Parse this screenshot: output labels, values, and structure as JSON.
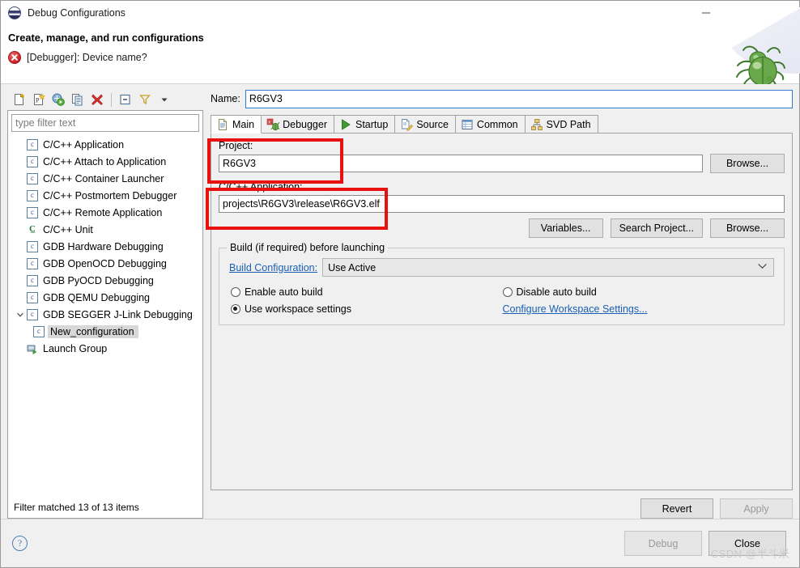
{
  "window": {
    "title": "Debug Configurations",
    "icon": "debug-configurations-icon",
    "minimize_label": "—",
    "maximize_label": "☐",
    "close_label": "✕"
  },
  "header": {
    "title": "Create, manage, and run configurations",
    "error_message": "[Debugger]: Device name?",
    "error_icon": "error-icon",
    "decoration_icon": "green-bug-icon"
  },
  "toolbar": {
    "buttons": [
      {
        "name": "new-launch-configuration-icon",
        "tooltip": "New launch configuration"
      },
      {
        "name": "new-prototype-icon",
        "tooltip": "New prototype"
      },
      {
        "name": "export-launch-configuration-icon",
        "tooltip": "Export"
      },
      {
        "name": "duplicate-icon",
        "tooltip": "Duplicate"
      },
      {
        "name": "delete-icon",
        "tooltip": "Delete"
      },
      {
        "name": "collapse-all-icon",
        "tooltip": "Collapse All"
      },
      {
        "name": "filter-icon",
        "tooltip": "Filter"
      },
      {
        "name": "view-menu-icon",
        "tooltip": "View Menu"
      }
    ]
  },
  "filter": {
    "placeholder": "type filter text",
    "value": ""
  },
  "tree": {
    "items": [
      {
        "label": "C/C++ Application",
        "icon": "c-launch-icon",
        "level": 0,
        "expandable": false,
        "selected": false
      },
      {
        "label": "C/C++ Attach to Application",
        "icon": "c-launch-icon",
        "level": 0,
        "expandable": false,
        "selected": false
      },
      {
        "label": "C/C++ Container Launcher",
        "icon": "c-launch-icon",
        "level": 0,
        "expandable": false,
        "selected": false
      },
      {
        "label": "C/C++ Postmortem Debugger",
        "icon": "c-launch-icon",
        "level": 0,
        "expandable": false,
        "selected": false
      },
      {
        "label": "C/C++ Remote Application",
        "icon": "c-launch-icon",
        "level": 0,
        "expandable": false,
        "selected": false
      },
      {
        "label": "C/C++ Unit",
        "icon": "cunit-icon",
        "level": 0,
        "expandable": false,
        "selected": false
      },
      {
        "label": "GDB Hardware Debugging",
        "icon": "c-launch-icon",
        "level": 0,
        "expandable": false,
        "selected": false
      },
      {
        "label": "GDB OpenOCD Debugging",
        "icon": "c-launch-icon",
        "level": 0,
        "expandable": false,
        "selected": false
      },
      {
        "label": "GDB PyOCD Debugging",
        "icon": "c-launch-icon",
        "level": 0,
        "expandable": false,
        "selected": false
      },
      {
        "label": "GDB QEMU Debugging",
        "icon": "c-launch-icon",
        "level": 0,
        "expandable": false,
        "selected": false
      },
      {
        "label": "GDB SEGGER J-Link Debugging",
        "icon": "c-launch-icon",
        "level": 0,
        "expandable": true,
        "expanded": true,
        "selected": false
      },
      {
        "label": "New_configuration",
        "icon": "c-launch-icon",
        "level": 1,
        "expandable": false,
        "selected": true
      },
      {
        "label": "Launch Group",
        "icon": "launch-group-icon",
        "level": 0,
        "expandable": false,
        "selected": false
      }
    ],
    "status": "Filter matched 13 of 13 items"
  },
  "config": {
    "name_label": "Name:",
    "name_value": "R6GV3",
    "tabs": [
      {
        "label": "Main",
        "icon": "main-tab-icon",
        "active": true
      },
      {
        "label": "Debugger",
        "icon": "debugger-tab-icon",
        "active": false
      },
      {
        "label": "Startup",
        "icon": "startup-tab-icon",
        "active": false
      },
      {
        "label": "Source",
        "icon": "source-tab-icon",
        "active": false
      },
      {
        "label": "Common",
        "icon": "common-tab-icon",
        "active": false
      },
      {
        "label": "SVD Path",
        "icon": "svd-path-tab-icon",
        "active": false
      }
    ],
    "project": {
      "label": "Project:",
      "value": "R6GV3",
      "browse_label": "Browse..."
    },
    "application": {
      "label": "C/C++ Application:",
      "value": "projects\\R6GV3\\release\\R6GV3.elf",
      "variables_label": "Variables...",
      "search_project_label": "Search Project...",
      "browse_label": "Browse..."
    },
    "build_group": {
      "title": "Build (if required) before launching",
      "build_configuration_label": "Build Configuration:",
      "build_configuration_value": "Use Active",
      "options": [
        {
          "label": "Enable auto build",
          "checked": false
        },
        {
          "label": "Disable auto build",
          "checked": false
        },
        {
          "label": "Use workspace settings",
          "checked": true
        }
      ],
      "configure_workspace_link": "Configure Workspace Settings..."
    },
    "revert_label": "Revert",
    "apply_label": "Apply"
  },
  "footer": {
    "help_label": "?",
    "debug_label": "Debug",
    "close_label": "Close"
  },
  "watermark": "CSDN @半斗米",
  "annotations": {
    "highlight_color": "#e8110f",
    "boxes": [
      {
        "name": "project-field-highlight"
      },
      {
        "name": "application-field-highlight"
      }
    ]
  }
}
